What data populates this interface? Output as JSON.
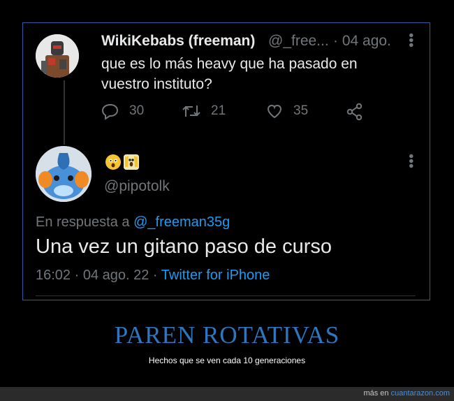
{
  "tweet": {
    "author_name": "WikiKebabs (freeman)",
    "author_handle": "@_free...",
    "date": "· 04 ago.",
    "text": "que es lo más heavy que ha pasado en vuestro instituto?",
    "replies": "30",
    "retweets": "21",
    "likes": "35"
  },
  "reply": {
    "author_name_emojis": [
      "astonished-face-emoji",
      "screaming-face-emoji"
    ],
    "author_handle": "@pipotolk",
    "replying_to_label": "En respuesta a",
    "replying_to_handle": "@_freeman35g",
    "text": "Una vez un gitano paso de curso",
    "time": "16:02 · 04 ago. 22 ·",
    "source": "Twitter for iPhone"
  },
  "caption": {
    "headline": "PAREN ROTATIVAS",
    "subtitle": "Hechos que se ven cada 10 generaciones"
  },
  "footer": {
    "prefix": "más en",
    "site": "cuantarazon.com"
  },
  "colors": {
    "link": "#1d9bf0",
    "muted": "#71767b",
    "headline": "#2e77bf",
    "frame_border": "#2f5aa8"
  }
}
